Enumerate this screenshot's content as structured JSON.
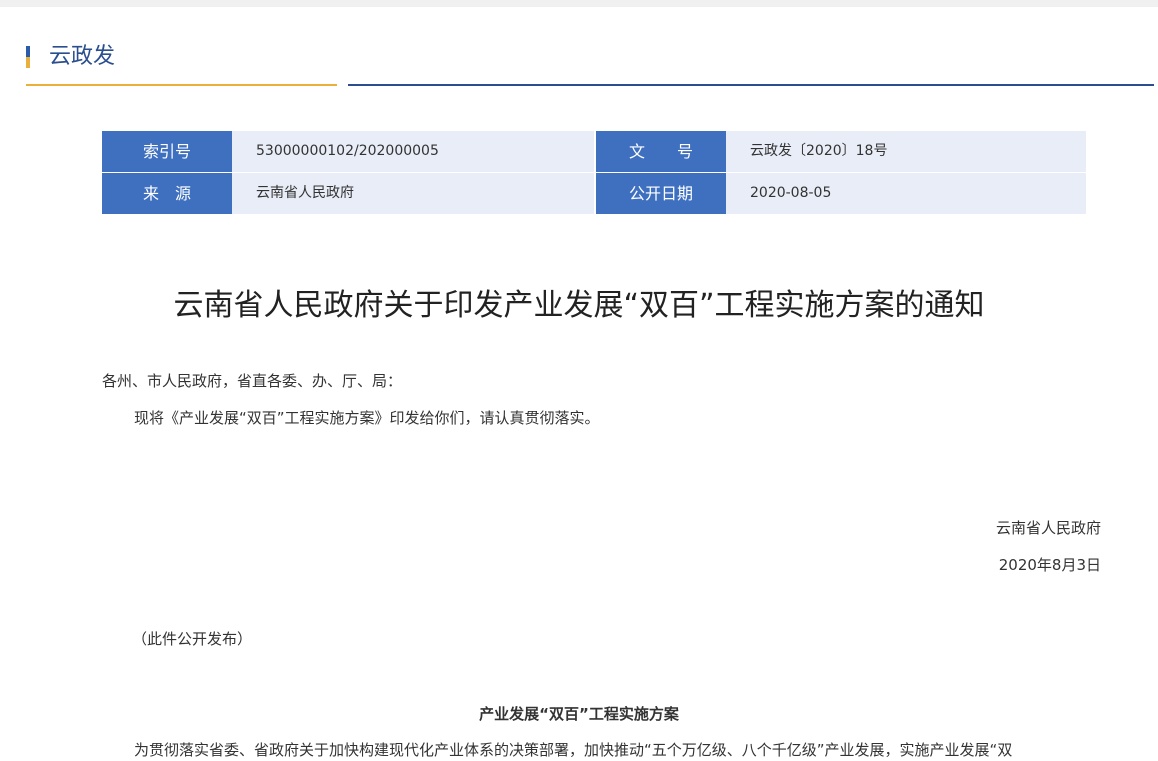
{
  "section": {
    "title": "云政发"
  },
  "meta": {
    "index_label": "索引号",
    "index_value": "53000000102/202000005",
    "docno_label": "文　　号",
    "docno_value": "云政发〔2020〕18号",
    "source_label": "来　源",
    "source_value": "云南省人民政府",
    "date_label": "公开日期",
    "date_value": "2020-08-05"
  },
  "document": {
    "title": "云南省人民政府关于印发产业发展“双百”工程实施方案的通知",
    "salutation": "各州、市人民政府，省直各委、办、厅、局：",
    "body": "现将《产业发展“双百”工程实施方案》印发给你们，请认真贯彻落实。",
    "signature_org": "云南省人民政府",
    "signature_date": "2020年8月3日",
    "publish_note": "（此件公开发布）",
    "plan_title": "产业发展“双百”工程实施方案",
    "plan_body_first_line": "为贯彻落实省委、省政府关于加快构建现代化产业体系的决策部署，加快推动“五个万亿级、八个千亿级”产业发展，实施产业发展“双"
  },
  "colors": {
    "accent_blue": "#3f70c0",
    "accent_gold": "#e9b13b",
    "header_blue": "#2b4f8e",
    "cell_bg": "#e8edf7"
  }
}
